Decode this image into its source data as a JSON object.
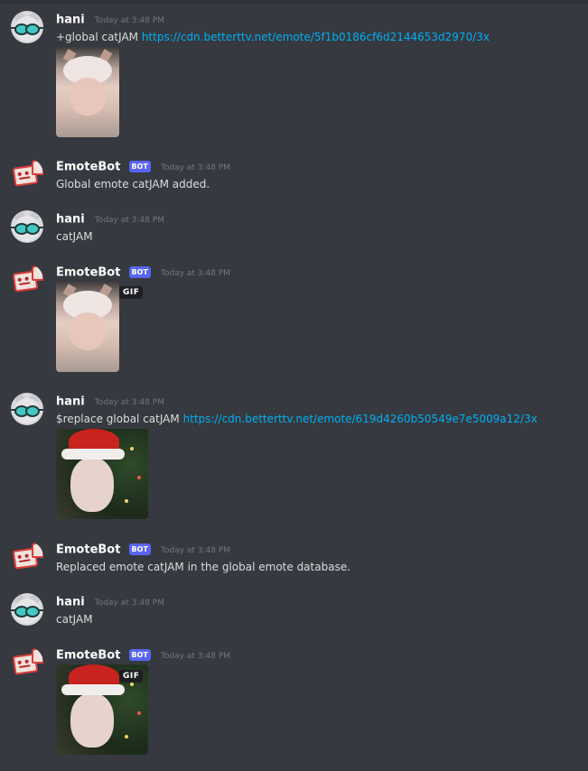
{
  "messages": [
    {
      "author": "hani",
      "avatar_icon": "cat-goggles-avatar",
      "bot": false,
      "timestamp": "Today at 3:48 PM",
      "text": "+global catJAM ",
      "link": "https://cdn.betterttv.net/emote/5f1b0186cf6d2144653d2970/3x",
      "embed": "catjam-image"
    },
    {
      "author": "EmoteBot",
      "avatar_icon": "emotebot-avatar",
      "bot": true,
      "badge": "BOT",
      "timestamp": "Today at 3:48 PM",
      "text": "Global emote catJAM added."
    },
    {
      "author": "hani",
      "avatar_icon": "cat-goggles-avatar",
      "bot": false,
      "timestamp": "Today at 3:48 PM",
      "text": "catJAM"
    },
    {
      "author": "EmoteBot",
      "avatar_icon": "emotebot-avatar",
      "bot": true,
      "badge": "BOT",
      "timestamp": "Today at 3:48 PM",
      "embed": "catjam-gif",
      "gif_label": "GIF"
    },
    {
      "author": "hani",
      "avatar_icon": "cat-goggles-avatar",
      "bot": false,
      "timestamp": "Today at 3:48 PM",
      "text": "$replace global catJAM ",
      "link": "https://cdn.betterttv.net/emote/619d4260b50549e7e5009a12/3x",
      "embed": "santa-catjam-image"
    },
    {
      "author": "EmoteBot",
      "avatar_icon": "emotebot-avatar",
      "bot": true,
      "badge": "BOT",
      "timestamp": "Today at 3:48 PM",
      "text": "Replaced emote catJAM in the global emote database."
    },
    {
      "author": "hani",
      "avatar_icon": "cat-goggles-avatar",
      "bot": false,
      "timestamp": "Today at 3:48 PM",
      "text": "catJAM"
    },
    {
      "author": "EmoteBot",
      "avatar_icon": "emotebot-avatar",
      "bot": true,
      "badge": "BOT",
      "timestamp": "Today at 3:48 PM",
      "embed": "santa-catjam-gif",
      "gif_label": "GIF"
    }
  ],
  "colors": {
    "background": "#36393f",
    "link": "#00aff4",
    "bot_badge": "#5865f2",
    "username": "#ffffff",
    "timestamp": "#72767d"
  }
}
